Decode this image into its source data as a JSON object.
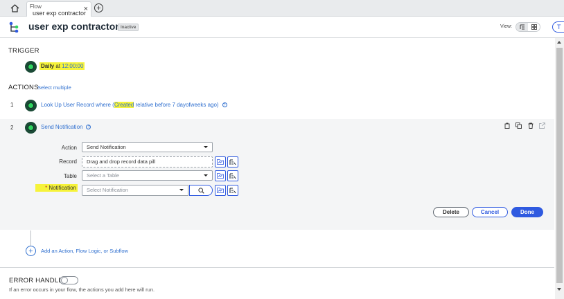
{
  "tabbar": {
    "tab_kind": "Flow",
    "tab_name": "user exp contractor",
    "close_glyph": "×",
    "add_glyph": "+"
  },
  "header": {
    "title": "user exp contractor",
    "status": "Inactive",
    "view_label": "View:",
    "right_button_label": "T"
  },
  "trigger": {
    "section_label": "TRIGGER",
    "schedule": "Daily",
    "at_word": "at",
    "time": "12:00:00"
  },
  "actions": {
    "section_label": "ACTIONS",
    "select_multiple": "Select multiple",
    "steps": [
      {
        "number": "1",
        "text_before": "Look Up User Record where (",
        "highlight": "Created",
        "text_after": " relative before 7 dayofweeks ago)"
      },
      {
        "number": "2",
        "text": "Send Notification"
      }
    ]
  },
  "form": {
    "action_label": "Action",
    "action_value": "Send Notification",
    "record_label": "Record",
    "record_placeholder": "Drag and drop record data pill",
    "table_label": "Table",
    "table_placeholder": "Select a Table",
    "notification_star": "*",
    "notification_label": "Notification",
    "notification_placeholder": "Select Notification"
  },
  "buttons": {
    "delete": "Delete",
    "cancel": "Cancel",
    "done": "Done"
  },
  "add_action": "Add an Action, Flow Logic, or Subflow",
  "error_handler": {
    "label": "ERROR HANDLER",
    "description": "If an error occurs in your flow, the actions you add here will run.",
    "enabled": false
  },
  "colors": {
    "accent": "#2f5ae0",
    "link": "#2f6fcf",
    "highlight": "#f6f33a",
    "node": "#2fd45f"
  },
  "icons": [
    "home-icon",
    "flow-structure-icon",
    "list-view-icon",
    "grid-view-icon",
    "help-icon",
    "copy-icon",
    "duplicate-icon",
    "trash-icon",
    "open-icon",
    "data-pill-picker-icon",
    "filter-icon",
    "search-icon"
  ]
}
